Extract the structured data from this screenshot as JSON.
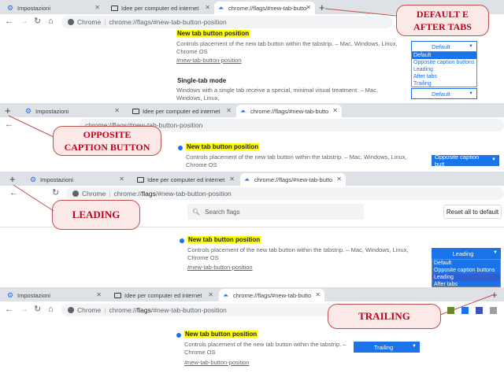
{
  "tabs": {
    "settings": "Impostazioni",
    "ideas": "Idee per computer ed internet",
    "flags": "chrome://flags/#new-tab-butto"
  },
  "omnibox": {
    "label": "Chrome",
    "url_prefix": "chrome://",
    "url_bold": "flags",
    "url_suffix": "/#new-tab-button-position",
    "url_short": "chrome://flags/#new-tab-button-position",
    "url_fragment": "/#new-tab-button-position"
  },
  "flag": {
    "title": "New tab button position",
    "description": "Controls placement of the new tab button within the tabstrip. – Mac, Windows, Linux, Chrome OS",
    "description_line1": "Controls placement of the new tab button within the tabstrip. – Mac, Windows, Linux,",
    "description_line2": "Chrome OS",
    "description_p4_line1": "Controls placement of the new tab button within the tabstrip. –",
    "description_p4_line2": "Chrome OS",
    "link": "#new-tab-button-position"
  },
  "single_tab": {
    "title": "Single-tab mode",
    "description_line1": "Windows with a single tab receive a special, minimal visual treatment. – Mac, Windows, Linux,",
    "description_line2": "Chrome OS"
  },
  "options": [
    "Default",
    "Opposite caption buttons",
    "Leading",
    "After tabs",
    "Trailing"
  ],
  "selects": {
    "panel1_top": "Default",
    "panel1_bottom": "Default",
    "panel2": "Opposite caption butt",
    "panel3": "Leading",
    "panel4": "Trailing"
  },
  "search": {
    "placeholder": "Search flags"
  },
  "reset_label": "Reset all to default",
  "callouts": {
    "default_after": "DEFAULT E\nAFTER TABS",
    "opposite": "OPPOSITE\nCAPTION BUTTON",
    "leading": "LEADING",
    "trailing": "TRAILING"
  },
  "colors": {
    "accent": "#1a73e8",
    "highlight": "#ffff00",
    "callout_text": "#c0001c",
    "callout_border": "#c0504d"
  }
}
